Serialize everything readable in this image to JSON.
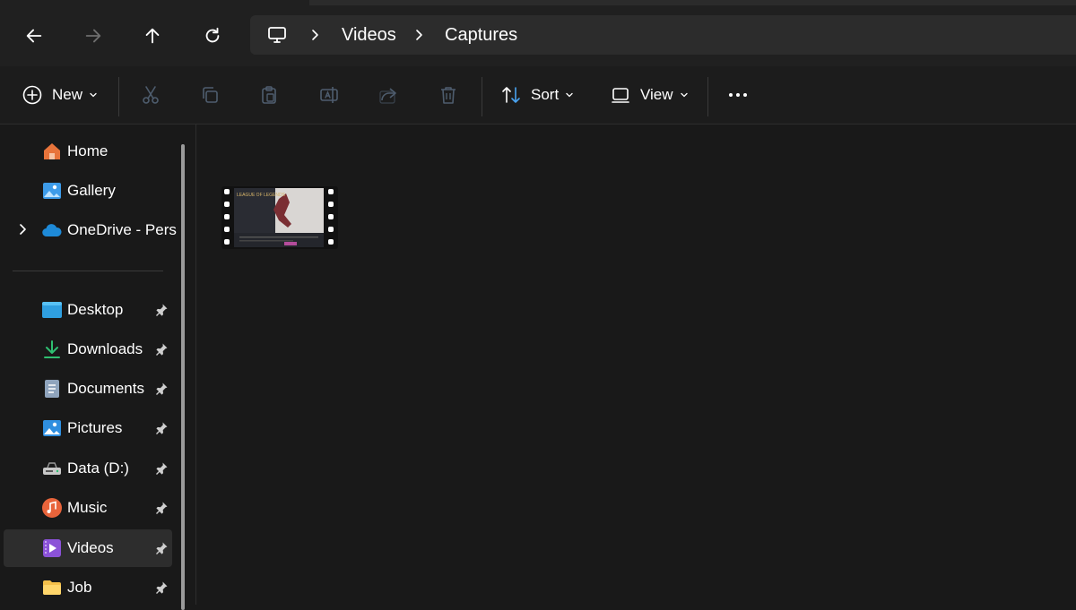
{
  "address": {
    "crumbs": [
      "Videos",
      "Captures"
    ],
    "root_icon": "monitor-icon"
  },
  "nav": {
    "back_icon": "arrow-left-icon",
    "forward_icon": "arrow-right-icon",
    "up_icon": "arrow-up-icon",
    "refresh_icon": "refresh-icon"
  },
  "toolbar": {
    "new_label": "New",
    "sort_label": "Sort",
    "view_label": "View"
  },
  "sidebar": {
    "top_items": [
      {
        "label": "Home",
        "icon": "home-icon"
      },
      {
        "label": "Gallery",
        "icon": "gallery-icon"
      },
      {
        "label": "OneDrive - Personal",
        "icon": "cloud-icon"
      }
    ],
    "pinned_items": [
      {
        "label": "Desktop",
        "icon": "desktop-folder-icon"
      },
      {
        "label": "Downloads",
        "icon": "download-icon"
      },
      {
        "label": "Documents",
        "icon": "document-icon"
      },
      {
        "label": "Pictures",
        "icon": "pictures-icon"
      },
      {
        "label": "Data (D:)",
        "icon": "drive-icon"
      },
      {
        "label": "Music",
        "icon": "music-icon"
      },
      {
        "label": "Videos",
        "icon": "video-folder-icon"
      },
      {
        "label": "Job",
        "icon": "folder-icon"
      }
    ],
    "selected": "Videos"
  },
  "content": {
    "files": [
      {
        "type": "video",
        "thumbnail_text": "LEAGUE OF LEGENDS",
        "icon": "video-file-icon"
      }
    ]
  },
  "colors": {
    "background": "#191919",
    "topbar": "#202020",
    "address_bar": "#2c2c2c",
    "selected_item": "#2d2d2d",
    "accent_blue": "#4aa3f0"
  }
}
